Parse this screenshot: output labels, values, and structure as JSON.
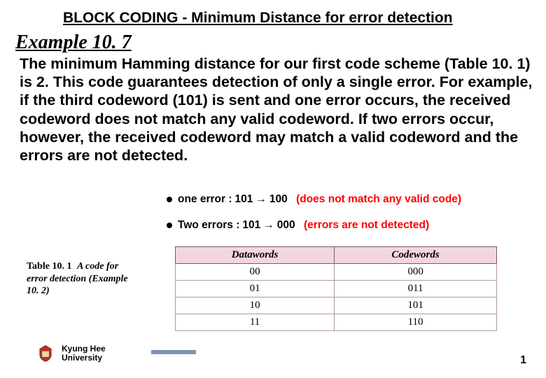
{
  "title": "BLOCK CODING - Minimum Distance for error detection",
  "example_label": "Example 10. 7",
  "body": "The minimum Hamming distance for our first code scheme (Table 10. 1) is 2. This code guarantees detection of only a single error. For example, if the third codeword (101) is sent and one error occurs, the received codeword does not match any valid codeword. If two errors occur, however, the received codeword may match a valid codeword and the errors are not detected.",
  "bullets": {
    "one": {
      "label": "one error  :",
      "from": "101",
      "to": "100",
      "note": "(does not match any valid code)"
    },
    "two": {
      "label": "Two errors :",
      "from": "101",
      "to": "000",
      "note": "(errors are not detected)"
    }
  },
  "caption": {
    "prefix": "Table 10. 1",
    "rest": "A code for error detection (Example 10. 2)"
  },
  "table": {
    "headers": {
      "c0": "Datawords",
      "c1": "Codewords"
    },
    "rows": [
      {
        "d": "00",
        "c": "000"
      },
      {
        "d": "01",
        "c": "011"
      },
      {
        "d": "10",
        "c": "101"
      },
      {
        "d": "11",
        "c": "110"
      }
    ]
  },
  "footer": {
    "line1": "Kyung Hee",
    "line2": "University"
  },
  "page_number": "1",
  "chart_data": {
    "type": "table",
    "title": "Table 10.1 A code for error detection (Example 10.2)",
    "columns": [
      "Datawords",
      "Codewords"
    ],
    "rows": [
      [
        "00",
        "000"
      ],
      [
        "01",
        "011"
      ],
      [
        "10",
        "101"
      ],
      [
        "11",
        "110"
      ]
    ]
  }
}
